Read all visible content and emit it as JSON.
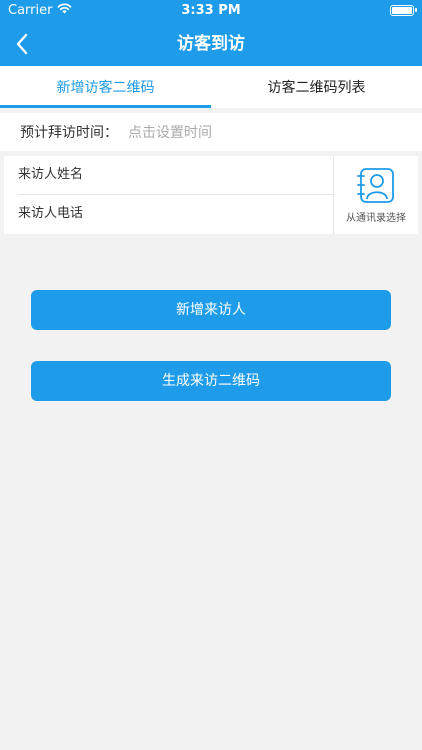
{
  "status_bar": {
    "carrier": "Carrier",
    "time": "3:33 PM",
    "wifi_icon": "wifi-icon",
    "battery_icon": "battery-icon"
  },
  "nav": {
    "title": "访客到访",
    "back_icon": "chevron-left-icon"
  },
  "tabs": [
    {
      "label": "新增访客二维码",
      "active": true
    },
    {
      "label": "访客二维码列表",
      "active": false
    }
  ],
  "visit_time": {
    "label": "预计拜访时间：",
    "placeholder": "点击设置时间"
  },
  "form": {
    "name_placeholder": "来访人姓名",
    "phone_placeholder": "来访人电话",
    "contacts_label": "从通讯录选择",
    "contacts_icon": "contact-book-icon"
  },
  "buttons": {
    "add_visitor": "新增来访人",
    "generate_qr": "生成来访二维码"
  },
  "colors": {
    "primary": "#1e9be9",
    "background": "#f2f2f2",
    "placeholder": "#aaaaaa"
  }
}
